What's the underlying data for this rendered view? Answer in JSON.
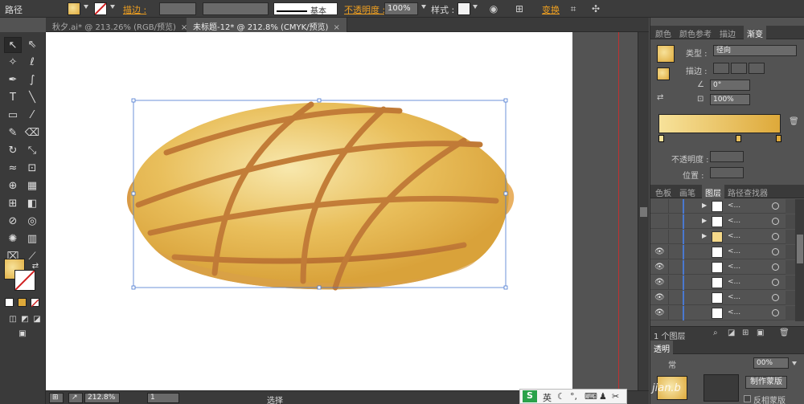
{
  "control_bar": {
    "object_type": "路径",
    "stroke_label": "描边 :",
    "stroke_style_label": "基本",
    "opacity_label": "不透明度 :",
    "opacity_value": "100%",
    "style_label": "样式 :",
    "transform_label": "变换"
  },
  "tabs": [
    {
      "label": "秋夕.ai* @ 213.26% (RGB/预览)"
    },
    {
      "label": "未标题-12* @ 212.8% (CMYK/预览)"
    }
  ],
  "gradient_panel": {
    "tabs": [
      "颜色",
      "颜色参考",
      "描边",
      "渐变"
    ],
    "type_label": "类型 :",
    "type_value": "径向",
    "stroke_label": "描边 :",
    "angle_value": "0°",
    "ratio_value": "100%",
    "opacity_label": "不透明度 :",
    "position_label": "位置 :",
    "colors": {
      "gradient_start": "#f7e29a",
      "gradient_end": "#dea93a"
    }
  },
  "layers_panel": {
    "tabs": [
      "色板",
      "画笔",
      "图层",
      "路径查找器"
    ],
    "rows": [
      {
        "name": "<...",
        "expanded": false
      },
      {
        "name": "<...",
        "expanded": false
      },
      {
        "name": "<...",
        "expanded": false
      },
      {
        "name": "<...",
        "expanded": false
      },
      {
        "name": "<...",
        "expanded": false
      },
      {
        "name": "<...",
        "expanded": false
      },
      {
        "name": "<...",
        "expanded": false
      },
      {
        "name": "<...",
        "expanded": false
      }
    ],
    "footer": "1 个图层"
  },
  "transparency_panel": {
    "tab": "透明",
    "mode_partial": "常",
    "opacity_value": "00%",
    "make_mask_button": "制作蒙版",
    "clip_label": "反相蒙版",
    "watermark": "jian.b"
  },
  "status_bar": {
    "zoom": "212.8%",
    "artboard": "1",
    "status": "选择"
  },
  "ime": {
    "lang": "英"
  }
}
